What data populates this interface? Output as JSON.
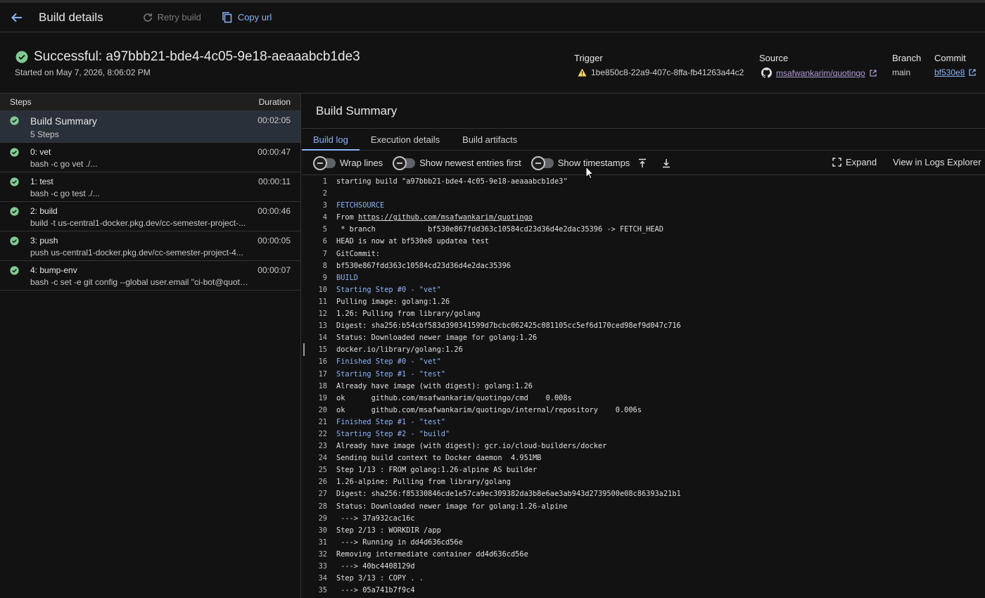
{
  "topbar": {
    "title": "Build details",
    "retry_label": "Retry build",
    "copy_label": "Copy url"
  },
  "header": {
    "status_title": "Successful: a97bbb21-bde4-4c05-9e18-aeaaabcb1de3",
    "started": "Started on May 7, 2026, 8:06:02 PM",
    "trigger_label": "Trigger",
    "trigger_value": "1be850c8-22a9-407c-8ffa-fb41263a44c2",
    "source_label": "Source",
    "source_value": "msafwankarim/quotingo",
    "branch_label": "Branch",
    "branch_value": "main",
    "commit_label": "Commit",
    "commit_value": "bf530e8"
  },
  "steps": {
    "col_steps": "Steps",
    "col_duration": "Duration",
    "items": [
      {
        "name": "Build Summary",
        "sub": "5 Steps",
        "duration": "00:02:05"
      },
      {
        "name": "0: vet",
        "sub": "bash -c go vet ./...",
        "duration": "00:00:47"
      },
      {
        "name": "1: test",
        "sub": "bash -c go test ./...",
        "duration": "00:00:11"
      },
      {
        "name": "2: build",
        "sub": "build -t us-central1-docker.pkg.dev/cc-semester-project-...",
        "duration": "00:00:46"
      },
      {
        "name": "3: push",
        "sub": "push us-central1-docker.pkg.dev/cc-semester-project-4...",
        "duration": "00:00:05"
      },
      {
        "name": "4: bump-env",
        "sub": "bash -c set -e git config --global user.email \"ci-bot@quoti...",
        "duration": "00:00:07"
      }
    ]
  },
  "main": {
    "title": "Build Summary",
    "tabs": [
      "Build log",
      "Execution details",
      "Build artifacts"
    ],
    "toolbar": {
      "wrap": "Wrap lines",
      "newest": "Show newest entries first",
      "timestamps": "Show timestamps",
      "expand": "Expand",
      "logs_explorer": "View in Logs Explorer"
    }
  },
  "log": [
    {
      "n": "1",
      "t": "starting build \"a97bbb21-bde4-4c05-9e18-aeaaabcb1de3\""
    },
    {
      "n": "2",
      "t": ""
    },
    {
      "n": "3",
      "t": "FETCHSOURCE",
      "hl": true
    },
    {
      "n": "4",
      "t": "From ",
      "link": "https://github.com/msafwankarim/quotingo"
    },
    {
      "n": "5",
      "t": " * branch            bf530e867fdd363c10584cd23d36d4e2dac35396 -> FETCH_HEAD"
    },
    {
      "n": "6",
      "t": "HEAD is now at bf530e8 updatea test"
    },
    {
      "n": "7",
      "t": "GitCommit:"
    },
    {
      "n": "8",
      "t": "bf530e867fdd363c10584cd23d36d4e2dac35396"
    },
    {
      "n": "9",
      "t": "BUILD",
      "hl": true
    },
    {
      "n": "10",
      "t": "Starting Step #0 - \"vet\"",
      "hl": true
    },
    {
      "n": "11",
      "t": "Pulling image: golang:1.26"
    },
    {
      "n": "12",
      "t": "1.26: Pulling from library/golang"
    },
    {
      "n": "13",
      "t": "Digest: sha256:b54cbf583d390341599d7bcbc062425c081105cc5ef6d170ced98ef9d047c716"
    },
    {
      "n": "14",
      "t": "Status: Downloaded newer image for golang:1.26"
    },
    {
      "n": "15",
      "t": "docker.io/library/golang:1.26"
    },
    {
      "n": "16",
      "t": "Finished Step #0 - \"vet\"",
      "hl": true
    },
    {
      "n": "17",
      "t": "Starting Step #1 - \"test\"",
      "hl": true
    },
    {
      "n": "18",
      "t": "Already have image (with digest): golang:1.26"
    },
    {
      "n": "19",
      "t": "ok      github.com/msafwankarim/quotingo/cmd    0.008s"
    },
    {
      "n": "20",
      "t": "ok      github.com/msafwankarim/quotingo/internal/repository    0.006s"
    },
    {
      "n": "21",
      "t": "Finished Step #1 - \"test\"",
      "hl": true
    },
    {
      "n": "22",
      "t": "Starting Step #2 - \"build\"",
      "hl": true
    },
    {
      "n": "23",
      "t": "Already have image (with digest): gcr.io/cloud-builders/docker"
    },
    {
      "n": "24",
      "t": "Sending build context to Docker daemon  4.951MB"
    },
    {
      "n": "25",
      "t": "Step 1/13 : FROM golang:1.26-alpine AS builder"
    },
    {
      "n": "26",
      "t": "1.26-alpine: Pulling from library/golang"
    },
    {
      "n": "27",
      "t": "Digest: sha256:f85330846cde1e57ca9ec309382da3b8e6ae3ab943d2739500e08c86393a21b1"
    },
    {
      "n": "28",
      "t": "Status: Downloaded newer image for golang:1.26-alpine"
    },
    {
      "n": "29",
      "t": " ---> 37a932cac16c"
    },
    {
      "n": "30",
      "t": "Step 2/13 : WORKDIR /app"
    },
    {
      "n": "31",
      "t": " ---> Running in dd4d636cd56e"
    },
    {
      "n": "32",
      "t": "Removing intermediate container dd4d636cd56e"
    },
    {
      "n": "33",
      "t": " ---> 40bc4408129d"
    },
    {
      "n": "34",
      "t": "Step 3/13 : COPY . ."
    },
    {
      "n": "35",
      "t": " ---> 05a741b7f9c4"
    }
  ]
}
